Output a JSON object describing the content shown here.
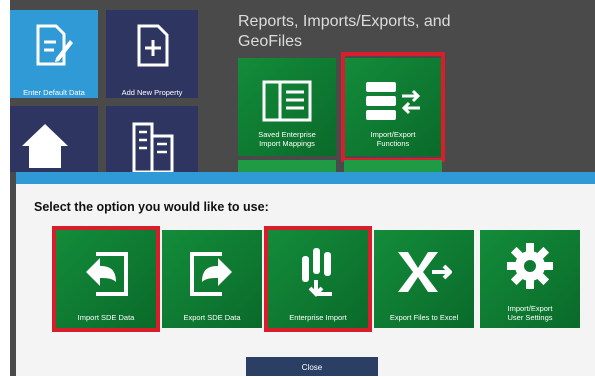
{
  "tiles": {
    "enter_default_data": "Enter Default Data",
    "add_new_property": "Add New Property",
    "saved_enterprise_import_mappings": "Saved Enterprise\nImport Mappings",
    "import_export_functions": "Import/Export\nFunctions"
  },
  "section": {
    "title": "Reports, Imports/Exports, and GeoFiles"
  },
  "dialog": {
    "prompt": "Select the option you would like to use:",
    "options": [
      {
        "label": "Import SDE Data",
        "icon": "import-arrow-icon",
        "highlighted": true
      },
      {
        "label": "Export SDE Data",
        "icon": "export-arrow-icon",
        "highlighted": false
      },
      {
        "label": "Enterprise Import",
        "icon": "enterprise-import-icon",
        "highlighted": true
      },
      {
        "label": "Export Files to Excel",
        "icon": "excel-export-icon",
        "highlighted": false
      },
      {
        "label": "Import/Export\nUser Settings",
        "icon": "gear-icon",
        "highlighted": false
      }
    ],
    "close_label": "Close"
  },
  "colors": {
    "tile_blue": "#2f9ad6",
    "tile_navy": "#2e3560",
    "tile_green": "#0f7a33",
    "highlight_red": "#d81e2a"
  }
}
